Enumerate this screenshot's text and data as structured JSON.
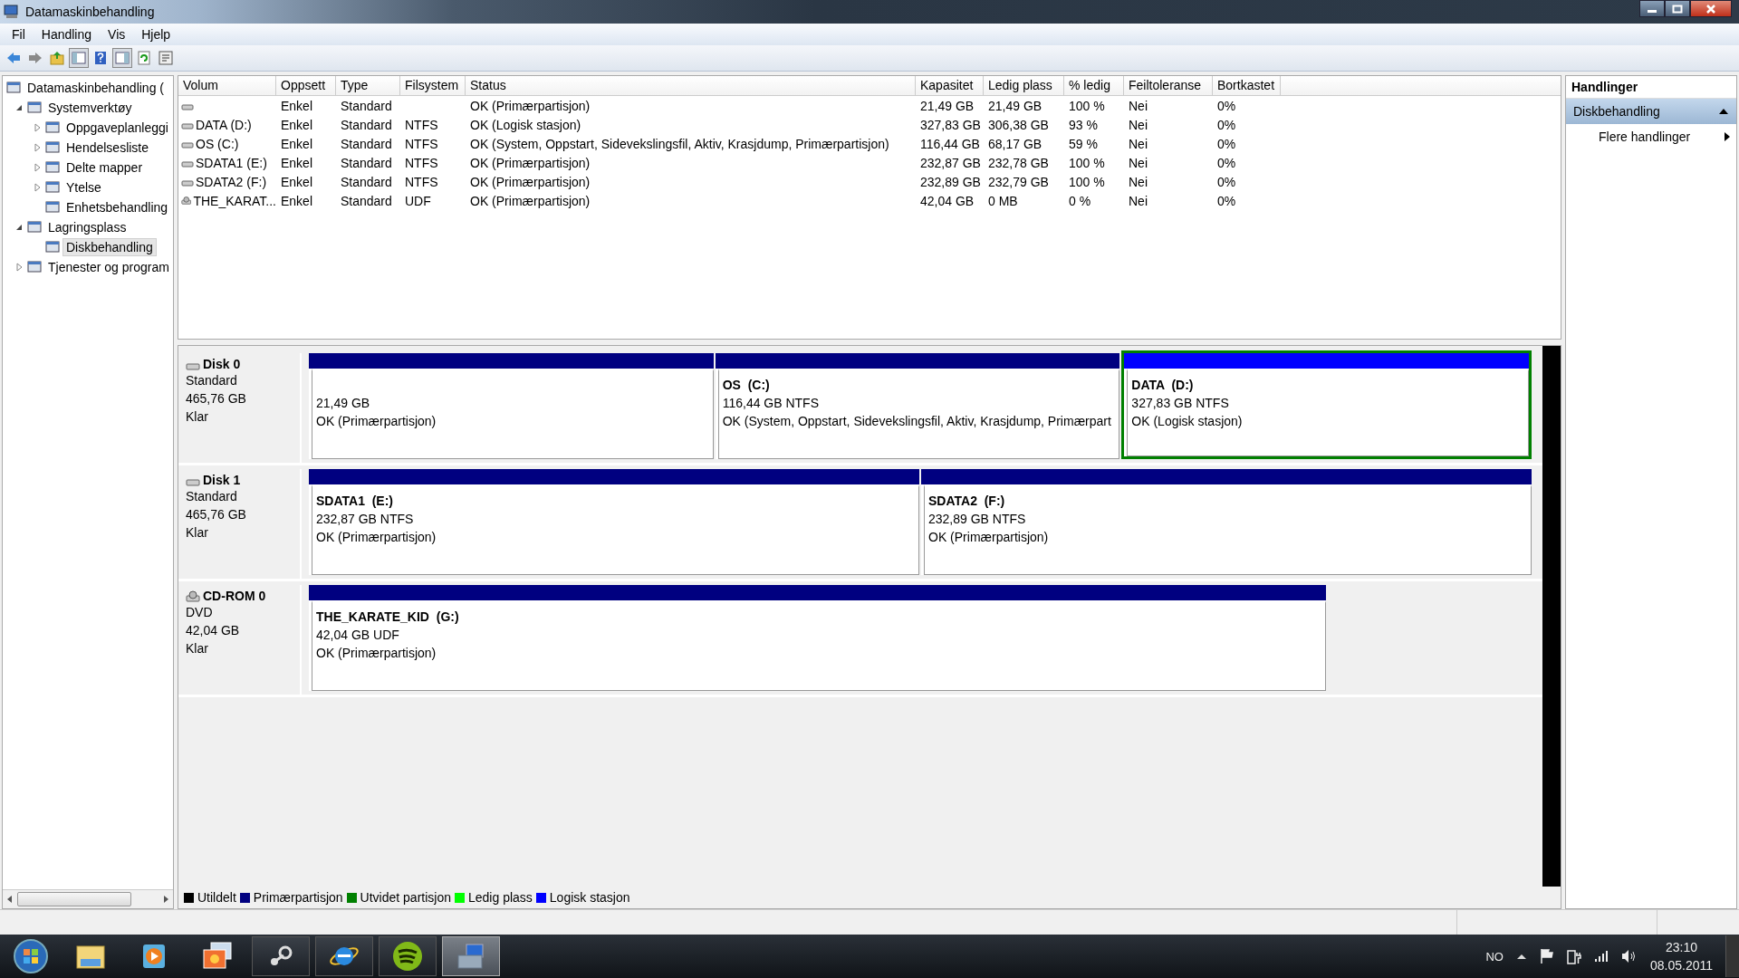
{
  "window": {
    "title": "Datamaskinbehandling"
  },
  "menu": [
    "Fil",
    "Handling",
    "Vis",
    "Hjelp"
  ],
  "toolbar": [
    {
      "kind": "back",
      "pressed": false
    },
    {
      "kind": "forward",
      "pressed": false
    },
    {
      "kind": "up",
      "pressed": false
    },
    {
      "kind": "tree",
      "pressed": true
    },
    {
      "kind": "help",
      "pressed": false
    },
    {
      "kind": "pane",
      "pressed": true
    },
    {
      "kind": "refresh",
      "pressed": false
    },
    {
      "kind": "properties",
      "pressed": false
    }
  ],
  "sidebar": {
    "items": [
      {
        "label": "Datamaskinbehandling (",
        "selected": false,
        "children": [
          {
            "label": "Systemverktøy",
            "expanded": true,
            "selected": false,
            "children": [
              {
                "label": "Oppgaveplanleggi",
                "expanded": false,
                "selected": false
              },
              {
                "label": "Hendelsesliste",
                "expanded": false,
                "selected": false
              },
              {
                "label": "Delte mapper",
                "expanded": false,
                "selected": false
              },
              {
                "label": "Ytelse",
                "expanded": false,
                "selected": false
              },
              {
                "label": "Enhetsbehandling",
                "selected": false
              }
            ]
          },
          {
            "label": "Lagringsplass",
            "expanded": true,
            "selected": false,
            "children": [
              {
                "label": "Diskbehandling",
                "selected": true
              }
            ]
          },
          {
            "label": "Tjenester og program",
            "expanded": false,
            "selected": false
          }
        ]
      }
    ]
  },
  "table": {
    "columns": [
      "Volum",
      "Oppsett",
      "Type",
      "Filsystem",
      "Status",
      "Kapasitet",
      "Ledig plass",
      "% ledig",
      "Feiltoleranse",
      "Bortkastet"
    ],
    "rows": [
      {
        "kind": "disk",
        "cells": [
          "",
          "Enkel",
          "Standard",
          "",
          "OK (Primærpartisjon)",
          "21,49 GB",
          "21,49 GB",
          "100 %",
          "Nei",
          "0%"
        ]
      },
      {
        "kind": "disk",
        "cells": [
          "DATA (D:)",
          "Enkel",
          "Standard",
          "NTFS",
          "OK (Logisk stasjon)",
          "327,83 GB",
          "306,38 GB",
          "93 %",
          "Nei",
          "0%"
        ]
      },
      {
        "kind": "disk",
        "cells": [
          "OS (C:)",
          "Enkel",
          "Standard",
          "NTFS",
          "OK (System, Oppstart, Sidevekslingsfil, Aktiv, Krasjdump, Primærpartisjon)",
          "116,44 GB",
          "68,17 GB",
          "59 %",
          "Nei",
          "0%"
        ]
      },
      {
        "kind": "disk",
        "cells": [
          "SDATA1 (E:)",
          "Enkel",
          "Standard",
          "NTFS",
          "OK (Primærpartisjon)",
          "232,87 GB",
          "232,78 GB",
          "100 %",
          "Nei",
          "0%"
        ]
      },
      {
        "kind": "disk",
        "cells": [
          "SDATA2 (F:)",
          "Enkel",
          "Standard",
          "NTFS",
          "OK (Primærpartisjon)",
          "232,89 GB",
          "232,79 GB",
          "100 %",
          "Nei",
          "0%"
        ]
      },
      {
        "kind": "cdrom",
        "cells": [
          "THE_KARAT...",
          "Enkel",
          "Standard",
          "UDF",
          "OK (Primærpartisjon)",
          "42,04 GB",
          "0 MB",
          "0 %",
          "Nei",
          "0%"
        ]
      }
    ]
  },
  "disks": [
    {
      "kind": "disk",
      "name": "Disk 0",
      "type": "Standard",
      "size": "465,76 GB",
      "status": "Klar",
      "partitions": [
        {
          "kind": "primary",
          "size": "21,49 GB",
          "status": "OK (Primærpartisjon)"
        },
        {
          "kind": "primary",
          "title": "OS  (C:)",
          "size": "116,44 GB NTFS",
          "status": "OK (System, Oppstart, Sidevekslingsfil, Aktiv, Krasjdump, Primærpart"
        },
        {
          "kind": "logical",
          "title": "DATA  (D:)",
          "size": "327,83 GB NTFS",
          "status": "OK (Logisk stasjon)"
        }
      ]
    },
    {
      "kind": "disk",
      "name": "Disk 1",
      "type": "Standard",
      "size": "465,76 GB",
      "status": "Klar",
      "partitions": [
        {
          "kind": "primary",
          "title": "SDATA1  (E:)",
          "size": "232,87 GB NTFS",
          "status": "OK (Primærpartisjon)"
        },
        {
          "kind": "primary",
          "title": "SDATA2  (F:)",
          "size": "232,89 GB NTFS",
          "status": "OK (Primærpartisjon)"
        }
      ]
    },
    {
      "kind": "cdrom",
      "name": "CD-ROM 0",
      "type": "DVD",
      "size": "42,04 GB",
      "status": "Klar",
      "partitions": [
        {
          "kind": "primary",
          "title": "THE_KARATE_KID  (G:)",
          "size": "42,04 GB UDF",
          "status": "OK (Primærpartisjon)"
        }
      ]
    }
  ],
  "legend": [
    {
      "label": "Utildelt",
      "color": "#000000"
    },
    {
      "label": "Primærpartisjon",
      "color": "#000080"
    },
    {
      "label": "Utvidet partisjon",
      "color": "#008000"
    },
    {
      "label": "Ledig plass",
      "color": "#00ff00"
    },
    {
      "label": "Logisk stasjon",
      "color": "#0000ff"
    }
  ],
  "actions": {
    "title": "Handlinger",
    "section": {
      "label": "Diskbehandling",
      "expanded": true
    },
    "items": [
      "Flere handlinger"
    ]
  },
  "taskbar": {
    "apps": [
      {
        "kind": "folder",
        "running": false,
        "active": false
      },
      {
        "kind": "player",
        "running": false,
        "active": false
      },
      {
        "kind": "photos",
        "running": false,
        "active": false
      },
      {
        "kind": "steam",
        "running": true,
        "active": false
      },
      {
        "kind": "browser",
        "running": true,
        "active": false
      },
      {
        "kind": "music",
        "running": true,
        "active": false
      },
      {
        "kind": "toolbox",
        "running": true,
        "active": true
      }
    ],
    "language": "NO",
    "time": "23:10",
    "date": "08.05.2011"
  }
}
